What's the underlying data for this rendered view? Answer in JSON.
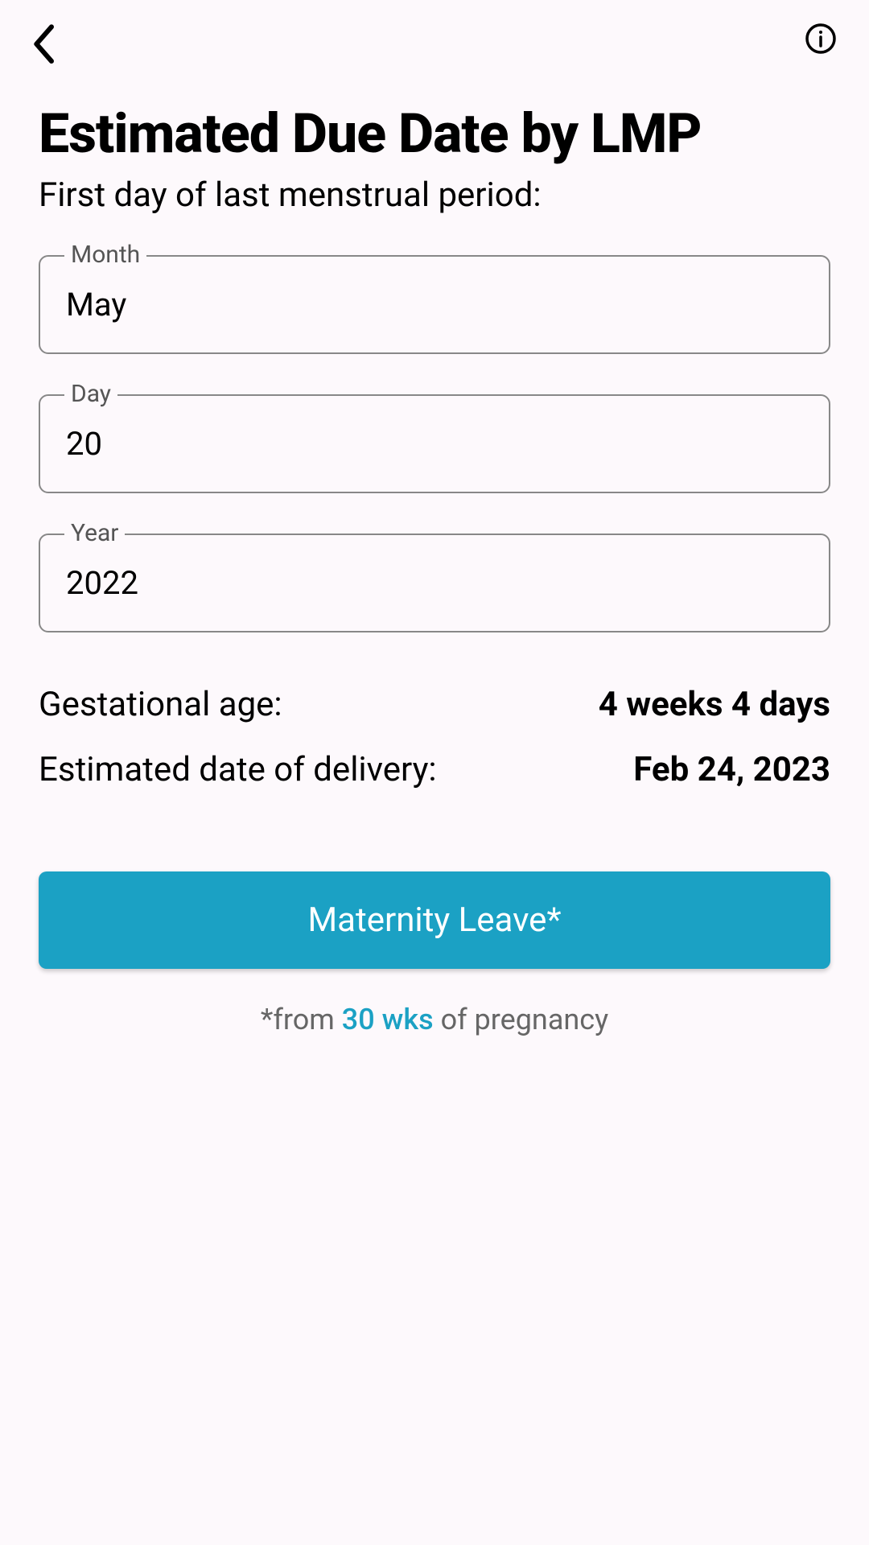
{
  "header": {
    "back_icon": "back",
    "info_icon": "info"
  },
  "page": {
    "title": "Estimated Due Date by LMP",
    "subtitle": "First day of last menstrual period:"
  },
  "fields": {
    "month": {
      "label": "Month",
      "value": "May"
    },
    "day": {
      "label": "Day",
      "value": "20"
    },
    "year": {
      "label": "Year",
      "value": "2022"
    }
  },
  "results": {
    "gestational_age": {
      "label": "Gestational age:",
      "value": "4 weeks 4 days"
    },
    "edd": {
      "label": "Estimated date of delivery:",
      "value": "Feb 24, 2023"
    }
  },
  "action": {
    "button_label": "Maternity Leave*"
  },
  "footnote": {
    "prefix": "*from ",
    "highlight": "30 wks",
    "suffix": " of pregnancy"
  }
}
